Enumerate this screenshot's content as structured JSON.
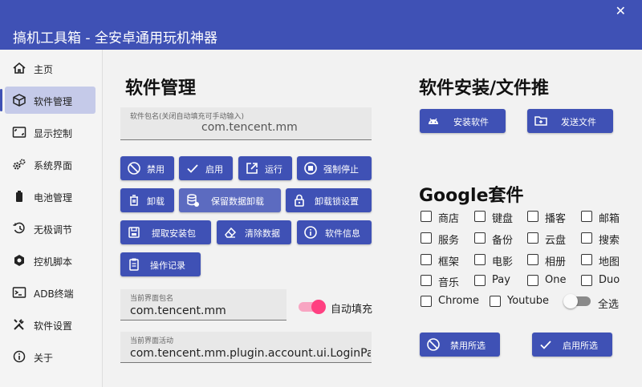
{
  "window": {
    "title": "搞机工具箱 - 全安卓通用玩机神器",
    "close_glyph": "✕"
  },
  "sidebar": {
    "items": [
      {
        "label": "主页",
        "icon": "home-icon"
      },
      {
        "label": "软件管理",
        "icon": "cube-icon",
        "active": true
      },
      {
        "label": "显示控制",
        "icon": "display-icon"
      },
      {
        "label": "系统界面",
        "icon": "gears-icon"
      },
      {
        "label": "电池管理",
        "icon": "battery-icon"
      },
      {
        "label": "无极调节",
        "icon": "history-icon"
      },
      {
        "label": "控机脚本",
        "icon": "hexagon-icon"
      },
      {
        "label": "ADB终端",
        "icon": "console-icon"
      },
      {
        "label": "软件设置",
        "icon": "tools-icon"
      },
      {
        "label": "关于",
        "icon": "info-icon"
      }
    ]
  },
  "app_manage": {
    "heading": "软件管理",
    "package_field": {
      "hint": "软件包名(关闭自动填充可手动输入)",
      "value": "com.tencent.mm"
    },
    "buttons": [
      {
        "label": "禁用",
        "icon": "block-icon"
      },
      {
        "label": "启用",
        "icon": "check-icon"
      },
      {
        "label": "运行",
        "icon": "launch-icon"
      },
      {
        "label": "强制停止",
        "icon": "stop-circle-icon"
      },
      {
        "label": "卸载",
        "icon": "trash-icon"
      },
      {
        "label": "保留数据卸载",
        "icon": "database-icon"
      },
      {
        "label": "卸载锁设置",
        "icon": "lock-icon"
      },
      {
        "label": "提取安装包",
        "icon": "save-icon"
      },
      {
        "label": "清除数据",
        "icon": "eraser-icon"
      },
      {
        "label": "软件信息",
        "icon": "info-icon"
      },
      {
        "label": "操作记录",
        "icon": "clipboard-icon"
      }
    ],
    "current_package": {
      "hint": "当前界面包名",
      "value": "com.tencent.mm"
    },
    "auto_fill": {
      "label": "自动填充",
      "on": true,
      "color": "#ff4081"
    },
    "current_activity": {
      "hint": "当前界面活动",
      "value": "com.tencent.mm.plugin.account.ui.LoginPa"
    }
  },
  "install": {
    "heading": "软件安装/文件推",
    "install_button": "安装软件",
    "send_button": "发送文件"
  },
  "google": {
    "heading": "Google套件",
    "items": [
      "商店",
      "键盘",
      "播客",
      "邮箱",
      "服务",
      "备份",
      "云盘",
      "搜索",
      "框架",
      "电影",
      "相册",
      "地图",
      "音乐",
      "Pay",
      "One",
      "Duo",
      "Chrome",
      "Youtube"
    ],
    "select_all": {
      "label": "全选",
      "on": false
    },
    "disable_selected": "禁用所选",
    "enable_selected": "启用所选"
  },
  "colors": {
    "primary": "#3f51b5",
    "primary_light": "#5c6bc0",
    "accent": "#ff4081",
    "active_bg": "#c5cae9"
  }
}
